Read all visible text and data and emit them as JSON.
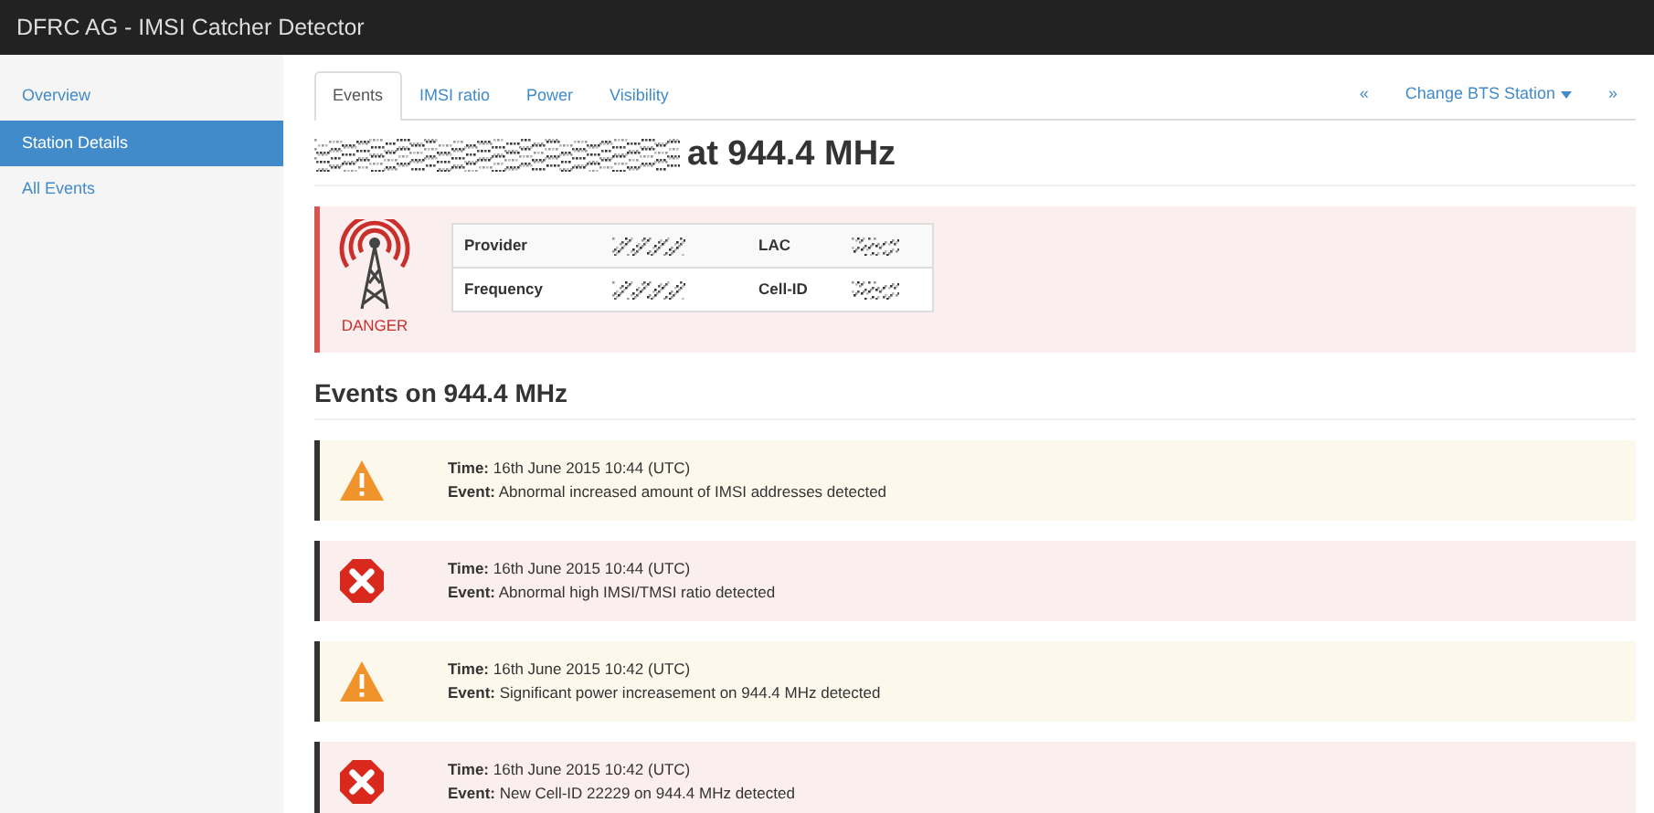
{
  "navbar": {
    "brand": "DFRC AG - IMSI Catcher Detector"
  },
  "sidebar": {
    "items": [
      {
        "label": "Overview",
        "selected": false
      },
      {
        "label": "Station Details",
        "selected": true
      },
      {
        "label": "All Events",
        "selected": false
      }
    ]
  },
  "tabs": [
    {
      "label": "Events",
      "selected": true
    },
    {
      "label": "IMSI ratio",
      "selected": false
    },
    {
      "label": "Power",
      "selected": false
    },
    {
      "label": "Visibility",
      "selected": false
    }
  ],
  "station_nav": {
    "previous": "«",
    "dropdown": "Change BTS Station",
    "next": "»"
  },
  "title": {
    "suffix": "at 944.4 MHz"
  },
  "status": {
    "kind": "danger",
    "label": "DANGER"
  },
  "station_info": [
    {
      "label": "Provider"
    },
    {
      "label": "LAC"
    },
    {
      "label": "Frequency"
    },
    {
      "label": "Cell-ID"
    }
  ],
  "events_heading": "Events on 944.4 MHz",
  "events": [
    {
      "kind": "warning",
      "time": "**Time:** 16th June 2015 10:44 (UTC)",
      "event": "**Event:** Abnormal increased amount of IMSI addresses detected"
    },
    {
      "kind": "danger",
      "time": "**Time:** 16th June 2015 10:44 (UTC)",
      "event": "**Event:** Abnormal high IMSI/TMSI ratio detected"
    },
    {
      "kind": "warning",
      "time": "**Time:** 16th June 2015 10:42 (UTC)",
      "event": "**Event:** Significant power increasement on 944.4 MHz detected"
    },
    {
      "kind": "danger",
      "time": "**Time:** 16th June 2015 10:42 (UTC)",
      "event": "**Event:** New Cell-ID 22229 on 944.4 MHz detected"
    }
  ]
}
